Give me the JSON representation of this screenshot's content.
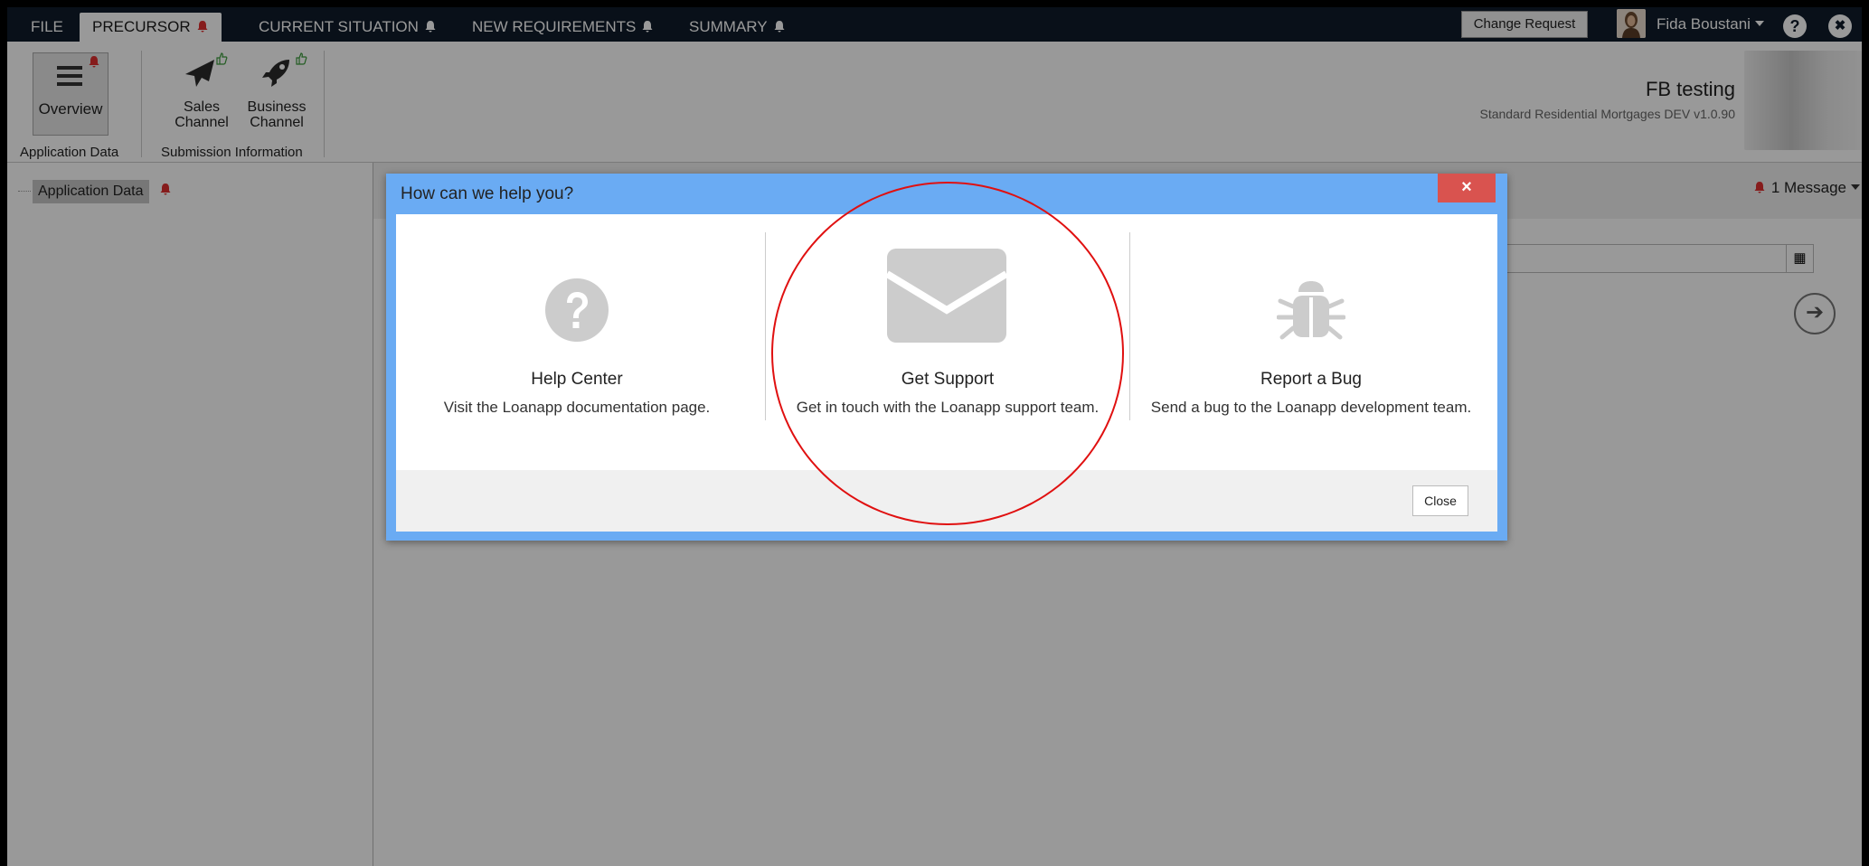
{
  "nav": {
    "tabs": [
      {
        "label": "FILE",
        "bell": false
      },
      {
        "label": "PRECURSOR",
        "bell": true,
        "bell_color": "#e03030"
      },
      {
        "label": "CURRENT SITUATION",
        "bell": true,
        "bell_color": "#ffffff"
      },
      {
        "label": "NEW REQUIREMENTS",
        "bell": true,
        "bell_color": "#ffffff"
      },
      {
        "label": "SUMMARY",
        "bell": true,
        "bell_color": "#ffffff"
      }
    ],
    "change_request_label": "Change Request",
    "user_name": "Fida Boustani",
    "help_icon": "?",
    "close_icon": "✖"
  },
  "ribbon": {
    "overview_label": "Overview",
    "sales_channel_label": "Sales Channel",
    "business_channel_label": "Business Channel",
    "group_application_data": "Application Data",
    "group_submission_information": "Submission Information",
    "app_title": "FB testing",
    "app_subtitle": "Standard Residential Mortgages DEV v1.0.90"
  },
  "tree": {
    "root_label": "Application Data"
  },
  "main": {
    "message_count_label": "1 Message",
    "calendar_icon": "▦",
    "go_icon": "➔"
  },
  "modal": {
    "title": "How can we help you?",
    "close_x": "×",
    "options": [
      {
        "icon": "question-icon",
        "title": "Help Center",
        "description": "Visit the Loanapp documentation page."
      },
      {
        "icon": "envelope-icon",
        "title": "Get Support",
        "description": "Get in touch with the Loanapp support team."
      },
      {
        "icon": "bug-icon",
        "title": "Report a Bug",
        "description": "Send a bug to the Loanapp development team."
      }
    ],
    "close_button_label": "Close"
  },
  "colors": {
    "nav_bg": "#0f1c2b",
    "modal_header": "#6aabf3",
    "close_x_bg": "#d9534f",
    "annotation_circle": "#e01010",
    "icon_gray": "#cccccc"
  }
}
